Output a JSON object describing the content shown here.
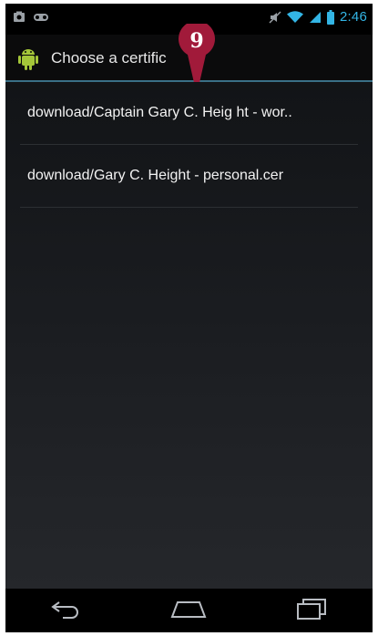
{
  "status_bar": {
    "time": "2:46",
    "icons": [
      "screenshot-icon",
      "voicemail-icon",
      "mute-icon",
      "wifi-icon",
      "signal-icon",
      "battery-icon"
    ]
  },
  "action_bar": {
    "app_icon": "android-icon",
    "title": "Choose a certific"
  },
  "callout": {
    "number": "9",
    "color": "#a11a3a"
  },
  "certificates": [
    {
      "label": "download/Captain Gary C. Heig ht - wor.."
    },
    {
      "label": "download/Gary C. Height - personal.cer"
    }
  ],
  "nav_bar": {
    "buttons": [
      "back-icon",
      "home-icon",
      "recent-apps-icon"
    ]
  },
  "colors": {
    "accent": "#33b5e5",
    "divider": "#3a6f86",
    "android_green": "#a4c639"
  }
}
